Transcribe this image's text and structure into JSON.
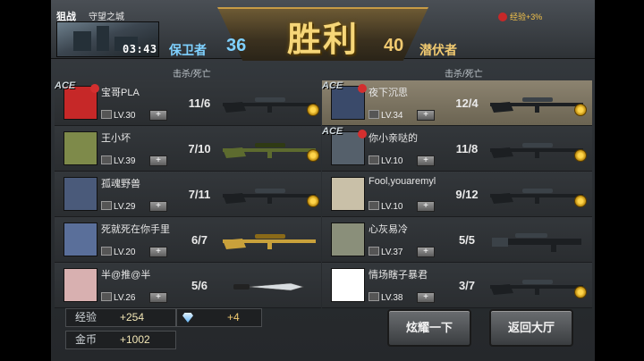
{
  "header": {
    "mode": "狙战",
    "map": "守望之城",
    "timer": "03:43",
    "result": "胜利",
    "bonus": "经验+3%"
  },
  "teams": {
    "blue": {
      "name": "保卫者",
      "score": "36",
      "kd_header": "击杀/死亡"
    },
    "red": {
      "name": "潜伏者",
      "score": "40",
      "kd_header": "击杀/死亡"
    }
  },
  "players_left": [
    {
      "name": "宝哥PLA",
      "level": "LV.30",
      "kd": "11/6",
      "weapon": "sniper-rifle",
      "ace": true,
      "medal": true,
      "avatar_color": "#c62828"
    },
    {
      "name": "王小坏",
      "level": "LV.39",
      "kd": "7/10",
      "weapon": "camo-sniper-rifle",
      "ace": false,
      "medal": true,
      "avatar_color": "#7e8a4a"
    },
    {
      "name": "孤魂野兽",
      "level": "LV.29",
      "kd": "7/11",
      "weapon": "sniper-rifle",
      "ace": false,
      "medal": true,
      "avatar_color": "#4a5a7a"
    },
    {
      "name": "死就死在你手里",
      "level": "LV.20",
      "kd": "6/7",
      "weapon": "gold-sniper-rifle",
      "ace": false,
      "medal": false,
      "avatar_color": "#5a6f9a"
    },
    {
      "name": "半@推@半",
      "level": "LV.26",
      "kd": "5/6",
      "weapon": "knife",
      "ace": false,
      "medal": false,
      "avatar_color": "#d8b0b0"
    }
  ],
  "players_right": [
    {
      "name": "夜下沉思",
      "level": "LV.34",
      "kd": "12/4",
      "weapon": "sniper-rifle",
      "ace": true,
      "medal": true,
      "highlight": true,
      "avatar_color": "#3a4a6a"
    },
    {
      "name": "你小亲哒的",
      "level": "LV.10",
      "kd": "11/8",
      "weapon": "sniper-rifle",
      "ace": true,
      "medal": true,
      "highlight": false,
      "avatar_color": "#55606b"
    },
    {
      "name": "Fool,youaremyl",
      "level": "LV.10",
      "kd": "9/12",
      "weapon": "sniper-rifle",
      "ace": false,
      "medal": true,
      "highlight": false,
      "avatar_color": "#c9c0a8"
    },
    {
      "name": "心灰易冷",
      "level": "LV.37",
      "kd": "5/5",
      "weapon": "heavy-sniper-rifle",
      "ace": false,
      "medal": false,
      "highlight": false,
      "avatar_color": "#8a8f7a"
    },
    {
      "name": "情场瞎子暴君",
      "level": "LV.38",
      "kd": "3/7",
      "weapon": "sniper-rifle",
      "ace": false,
      "medal": true,
      "highlight": false,
      "avatar_color": "#ffffff"
    }
  ],
  "rewards": {
    "exp_label": "经验",
    "exp_value": "+254",
    "gold_label": "金币",
    "gold_value": "+1002",
    "gem_value": "+4"
  },
  "buttons": {
    "show_off": "炫耀一下",
    "return_lobby": "返回大厅"
  },
  "colors": {
    "accent_gold": "#f6d678",
    "blue_team": "#7fd1ff",
    "red_team": "#f0c970",
    "highlight_row": "#8c8370"
  }
}
